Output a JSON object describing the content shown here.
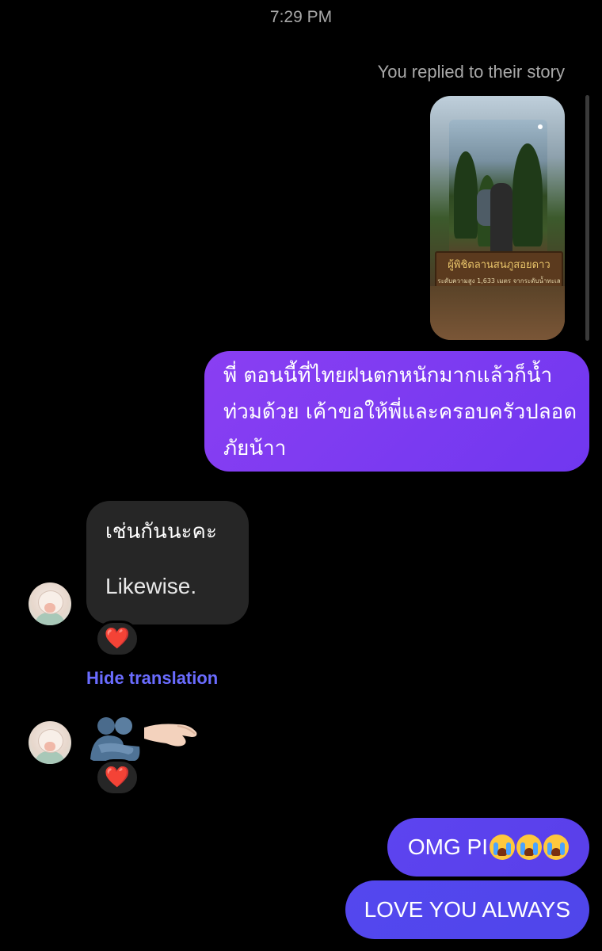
{
  "chat": {
    "timestamp": "7:29 PM",
    "story_reply_note": "You replied to their story",
    "story_sign": {
      "line1": "ผู้พิชิตลานสนภูสอยดาว",
      "line2": "ระดับความสูง 1,633 เมตร จากระดับน้ำทะเล"
    },
    "messages": {
      "outgoing_thai": "พี่ ตอนนี้ที่ไทยฝนตกหนักมากแล้วก็น้ำท่วมด้วย เค้าขอให้พี่และครอบครัวปลอดภัยน้าา",
      "incoming_thai": "เช่นกันนะคะ",
      "incoming_translation": "Likewise.",
      "hide_translation_label": "Hide translation",
      "reaction_1": "❤️",
      "reaction_2": "❤️",
      "outgoing_omg": "OMG PI",
      "outgoing_love": "LOVE YOU ALWAYS"
    }
  },
  "icons": {
    "avatar": "contact-avatar-icon",
    "hug_emoji": "people-hugging-emoji",
    "hand_emoji": "palm-down-hand-emoji",
    "crying_face": "loudly-crying-face-emoji"
  },
  "colors": {
    "background": "#000000",
    "outgoing_bubble": "#7c3aed",
    "outgoing_bubble_blue": "#5544ee",
    "incoming_bubble": "#262626",
    "link": "#6a6cff",
    "heart": "#ff2d2d"
  }
}
